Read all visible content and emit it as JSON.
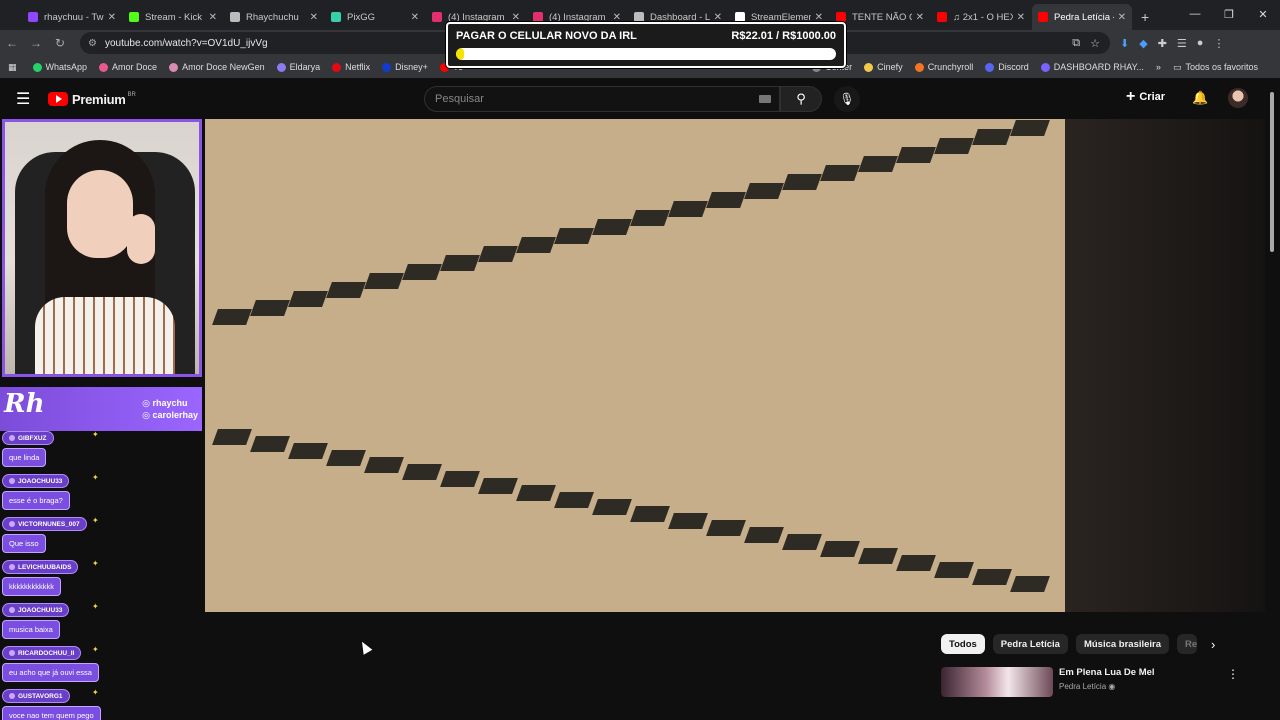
{
  "browser": {
    "tabs": [
      {
        "label": "rhaychuu - Twi",
        "color": "#9146ff"
      },
      {
        "label": "Stream - Kick C",
        "color": "#53fc18"
      },
      {
        "label": "Rhaychuchu",
        "color": "#bbbbbb"
      },
      {
        "label": "PixGG",
        "color": "#36d1a8"
      },
      {
        "label": "(4) Instagram",
        "color": "#e1306c"
      },
      {
        "label": "(4) Instagram",
        "color": "#e1306c"
      },
      {
        "label": "Dashboard - Li",
        "color": "#bbbbbb"
      },
      {
        "label": "StreamElemen",
        "color": "#ffffff"
      },
      {
        "label": "TENTE NÃO CA",
        "color": "#ff0000"
      },
      {
        "label": "♫ 2x1 - O HEX",
        "color": "#ff0000"
      },
      {
        "label": "Pedra Letícia -",
        "color": "#ff0000",
        "active": true
      }
    ],
    "url": "youtube.com/watch?v=OV1dU_ijvVg",
    "bookmarks": [
      {
        "label": "WhatsApp",
        "color": "#25d366"
      },
      {
        "label": "Amor Doce",
        "color": "#e85a8a"
      },
      {
        "label": "Amor Doce NewGen",
        "color": "#d98cb3"
      },
      {
        "label": "Eldarya",
        "color": "#8a7cf0"
      },
      {
        "label": "Netflix",
        "color": "#e50914"
      },
      {
        "label": "Disney+",
        "color": "#113ccf"
      },
      {
        "label": "Yo",
        "color": "#ff0000"
      }
    ],
    "bookmarks_right": [
      {
        "label": "Center",
        "color": "#888888"
      },
      {
        "label": "Cinefy",
        "color": "#f2c94c"
      },
      {
        "label": "Crunchyroll",
        "color": "#f47521"
      },
      {
        "label": "Discord",
        "color": "#5865f2"
      },
      {
        "label": "DASHBOARD RHAY...",
        "color": "#7b61ff"
      }
    ],
    "favorites_label": "Todos os favoritos"
  },
  "goal": {
    "title": "PAGAR O CELULAR NOVO DA IRL",
    "amount": "R$22.01 / R$1000.00",
    "progress": 0.022,
    "fill_color": "#f5e400"
  },
  "youtube": {
    "logo_text": "Premium",
    "region": "BR",
    "search_placeholder": "Pesquisar",
    "create_label": "Criar",
    "chips": [
      "Todos",
      "Pedra Letícia",
      "Música brasileira",
      "Re"
    ],
    "recommended": {
      "title": "Em Plena Lua De Mel",
      "channel": "Pedra Letícia ◉"
    }
  },
  "overlay": {
    "brand_logo": "Rh",
    "handles": [
      "◎ rhaychu",
      "◎ carolerhay"
    ],
    "chat": [
      {
        "user": "GIBFXUZ",
        "text": "que linda"
      },
      {
        "user": "JOAOCHUU33",
        "text": "esse é o braga?"
      },
      {
        "user": "VICTORNUNES_007",
        "text": "Que isso"
      },
      {
        "user": "LEVICHUUBAIDS",
        "text": "kkkkkkkkkkkk"
      },
      {
        "user": "JOAOCHUU33",
        "text": "musica baixa"
      },
      {
        "user": "RICARDOCHUU_II",
        "text": "eu acho que já ouvi essa"
      },
      {
        "user": "GUSTAVORG1",
        "text": "voce nao tem quem pego"
      }
    ]
  }
}
